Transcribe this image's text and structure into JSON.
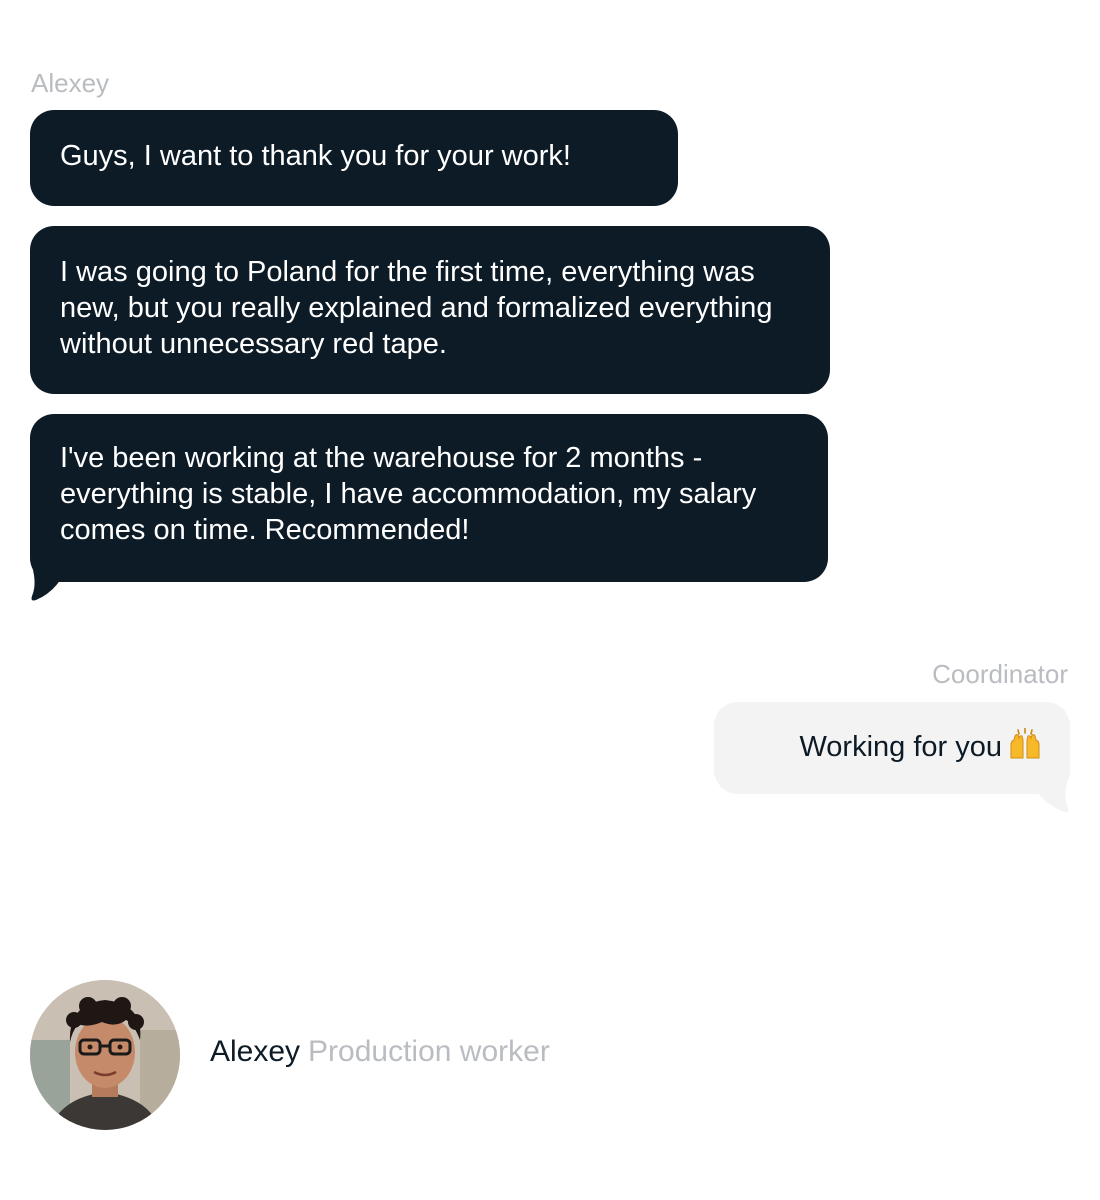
{
  "chat": {
    "left_sender": "Alexey",
    "messages_left": [
      {
        "text": "Guys, I want to thank you for your work!"
      },
      {
        "text": "I was going to Poland for the first time, everything was new, but you really explained and formalized everything without unnecessary red tape."
      },
      {
        "text": "I've been working at the warehouse for 2 months - everything is stable, I have accommodation, my salary comes on time. Recommended!"
      }
    ],
    "right_sender": "Coordinator",
    "message_right": {
      "text": "Working for you",
      "emoji": "raising-hands-icon"
    }
  },
  "profile": {
    "name": "Alexey",
    "role": "Production worker"
  },
  "colors": {
    "dark_bubble": "#0d1b26",
    "light_bubble": "#f3f3f4",
    "muted_text": "#b9bcc0"
  }
}
